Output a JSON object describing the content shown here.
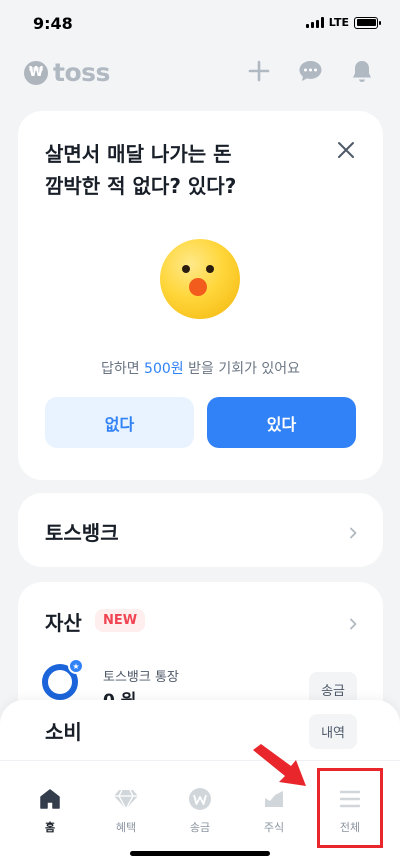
{
  "status_bar": {
    "time": "9:48",
    "network": "LTE"
  },
  "header": {
    "logo_text": "toss",
    "icons": [
      "plus-icon",
      "chat-bubble-icon",
      "bell-icon"
    ]
  },
  "survey_card": {
    "question": "살면서 매달 나가는 돈\n깜박한 적 없다? 있다?",
    "reward_prefix": "답하면 ",
    "reward_amount": "500원",
    "reward_suffix": " 받을 기회가 있어요",
    "no_label": "없다",
    "yes_label": "있다"
  },
  "bank_card": {
    "title": "토스뱅크"
  },
  "assets_card": {
    "title": "자산",
    "badge": "NEW",
    "account_name": "토스뱅크 통장",
    "account_balance": "0 원",
    "send_label": "송금"
  },
  "spending_panel": {
    "title": "소비",
    "history_label": "내역"
  },
  "tab_bar": {
    "tabs": [
      {
        "label": "홈",
        "icon": "home-icon",
        "active": true
      },
      {
        "label": "혜택",
        "icon": "diamond-icon",
        "active": false
      },
      {
        "label": "송금",
        "icon": "won-icon",
        "active": false
      },
      {
        "label": "주식",
        "icon": "chart-icon",
        "active": false
      },
      {
        "label": "전체",
        "icon": "menu-icon",
        "active": false
      }
    ]
  },
  "colors": {
    "accent": "#3182f6",
    "accent_light": "#e8f3ff",
    "annotation": "#e8262b",
    "background": "#f2f4f6"
  }
}
